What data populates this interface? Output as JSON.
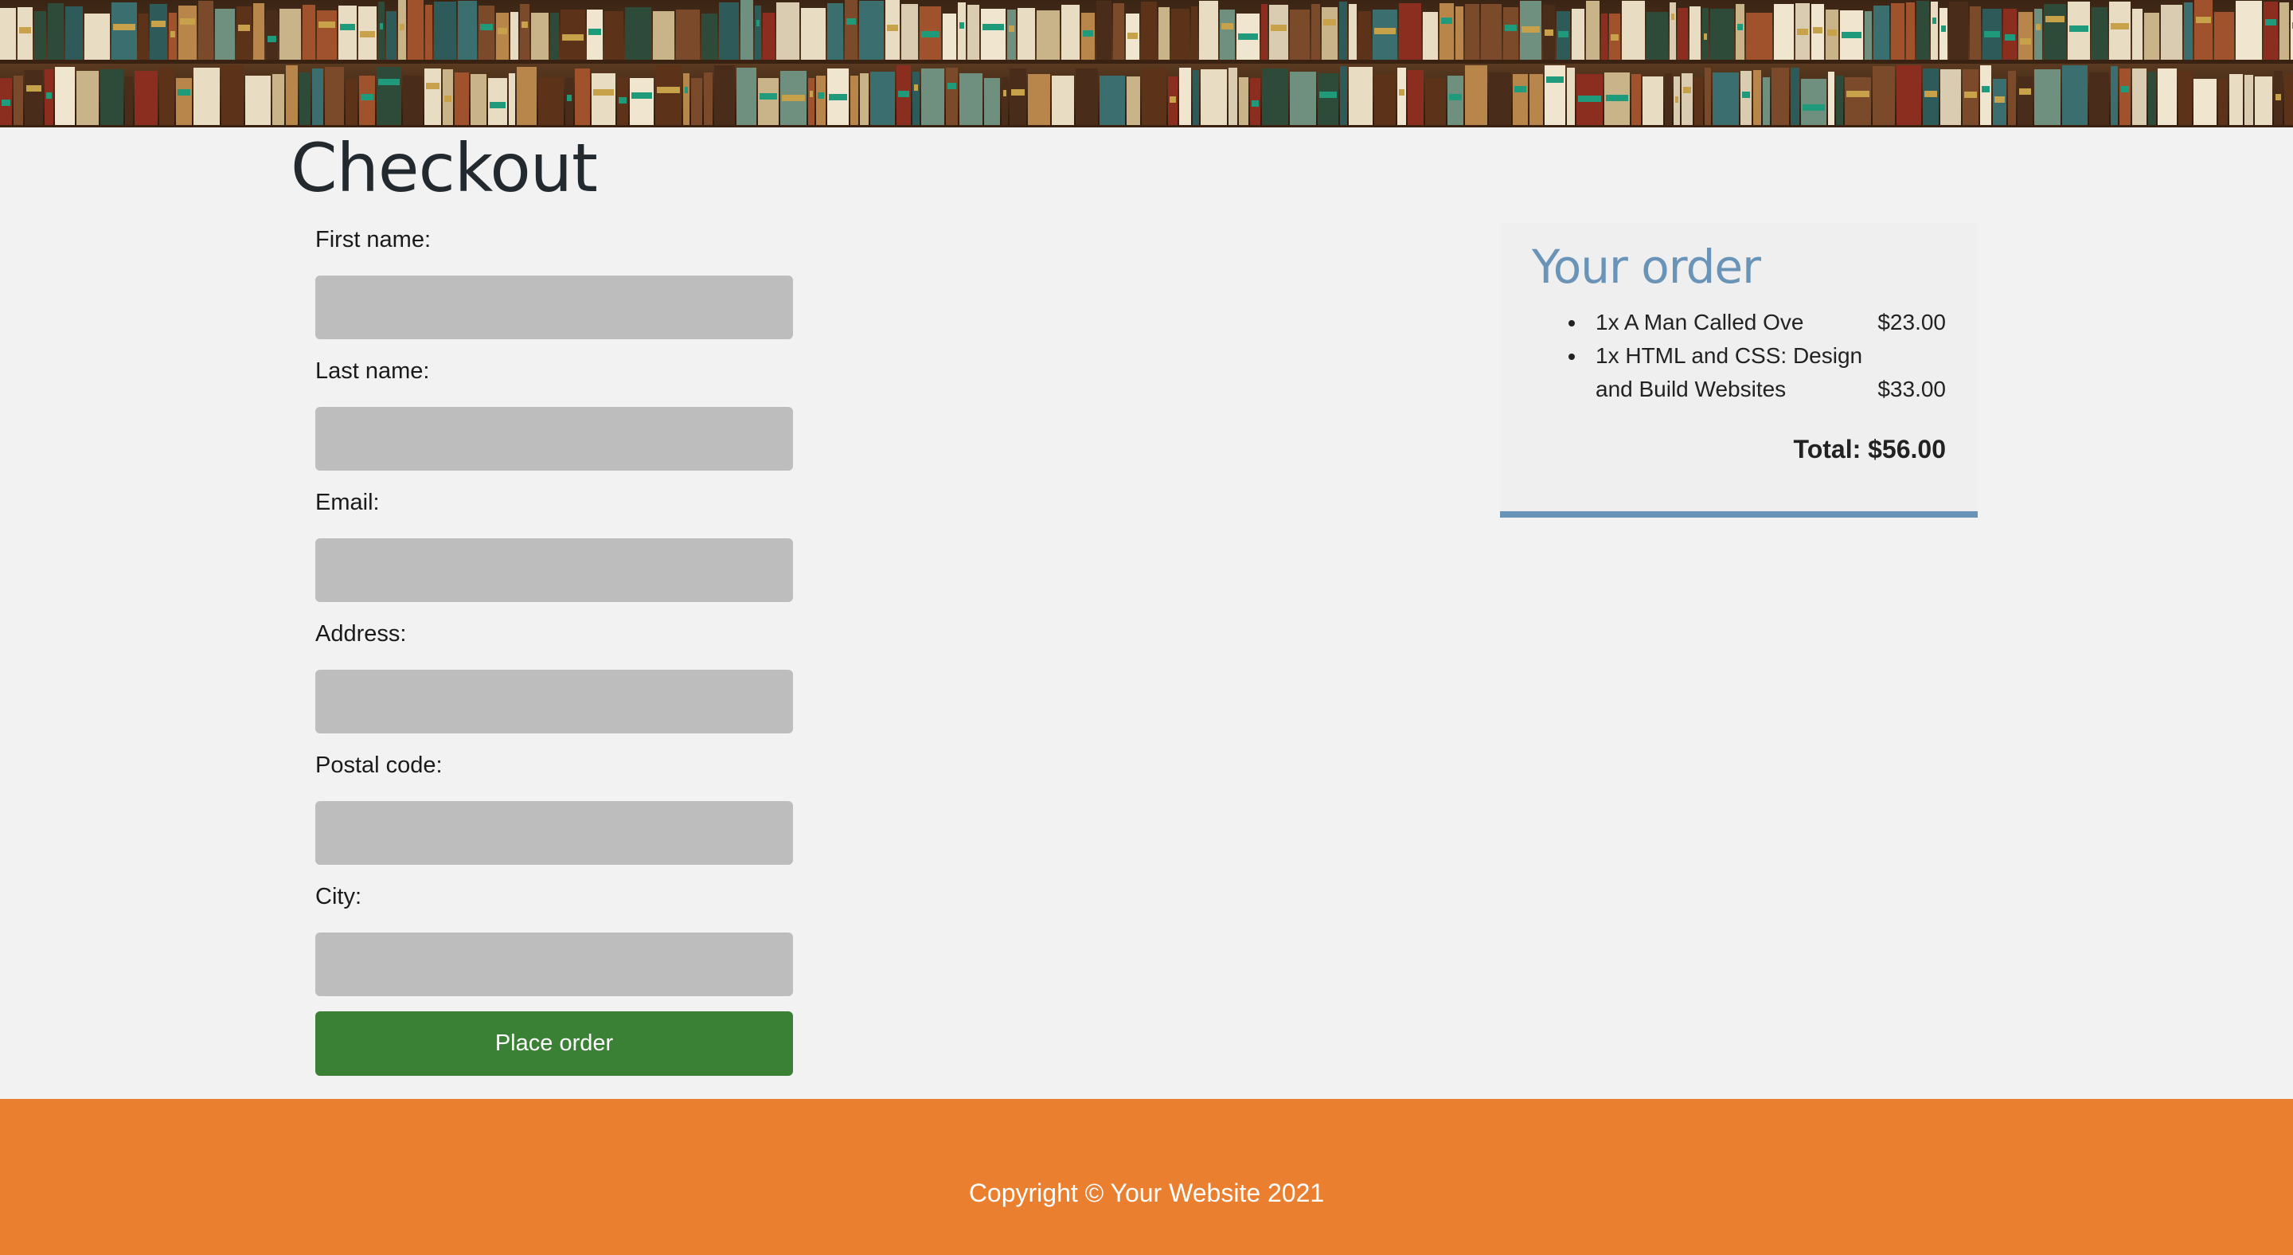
{
  "banner": {
    "icon": "bookshelf-image"
  },
  "page": {
    "title": "Checkout"
  },
  "form": {
    "fields": [
      {
        "label": "First name:",
        "value": "",
        "placeholder": ""
      },
      {
        "label": "Last name:",
        "value": "",
        "placeholder": ""
      },
      {
        "label": "Email:",
        "value": "",
        "placeholder": ""
      },
      {
        "label": "Address:",
        "value": "",
        "placeholder": ""
      },
      {
        "label": "Postal code:",
        "value": "",
        "placeholder": ""
      },
      {
        "label": "City:",
        "value": "",
        "placeholder": ""
      }
    ],
    "submit_label": "Place order"
  },
  "order": {
    "title": "Your order",
    "items": [
      {
        "qty": "1x",
        "name": "A Man Called Ove",
        "price": "$23.00"
      },
      {
        "qty": "1x",
        "name": "HTML and CSS: Design and Build Websites",
        "price": "$33.00"
      }
    ],
    "total": "Total: $56.00"
  },
  "footer": {
    "copyright": "Copyright © Your Website 2021"
  },
  "colors": {
    "accent": "#6a93b8",
    "button": "#3a8035",
    "footer": "#ea7f30",
    "background": "#f2f2f2",
    "input": "#bdbdbd"
  }
}
